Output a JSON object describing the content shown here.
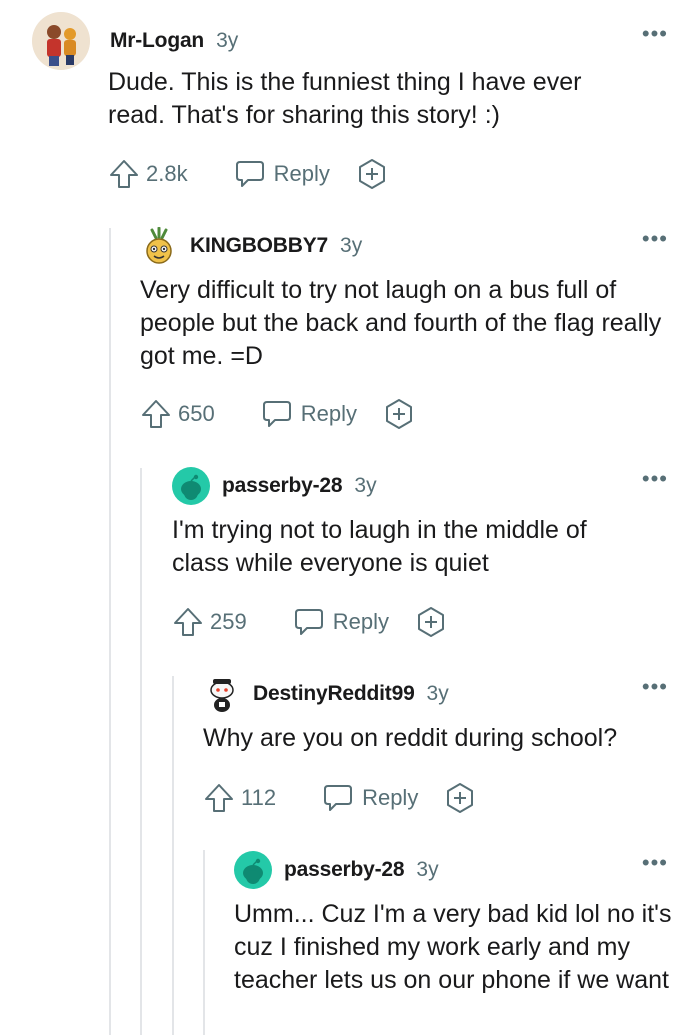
{
  "comments": [
    {
      "author": "Mr-Logan",
      "age": "3y",
      "more": "•••",
      "body": "Dude. This is the funniest thing I have ever read. That's for sharing this story! :)",
      "score": "2.8k",
      "reply_label": "Reply",
      "avatar": "user-avatar-illustration"
    },
    {
      "author": "KINGBOBBY7",
      "age": "3y",
      "more": "•••",
      "body": "Very difficult to try not laugh on a bus full of people but the back and fourth of the flag really got me. =D",
      "score": "650",
      "reply_label": "Reply",
      "avatar": "pineapple-avatar"
    },
    {
      "author": "passerby-28",
      "age": "3y",
      "more": "•••",
      "body": "I'm trying not to laugh in the middle of class while everyone is quiet",
      "score": "259",
      "reply_label": "Reply",
      "avatar": "default-snoo-avatar"
    },
    {
      "author": "DestinyReddit99",
      "age": "3y",
      "more": "•••",
      "body": "Why are you on reddit during school?",
      "score": "112",
      "reply_label": "Reply",
      "avatar": "snoo-character-avatar"
    },
    {
      "author": "passerby-28",
      "age": "3y",
      "more": "•••",
      "body": "Umm... Cuz I'm a very bad kid lol no it's cuz I finished my work early and my teacher lets us on our phone if we want",
      "avatar": "default-snoo-avatar"
    }
  ],
  "colors": {
    "text": "#1a1a1b",
    "meta": "#576f76",
    "thread_line": "#e3e5e8",
    "snoo_teal": "#24c9a8"
  }
}
